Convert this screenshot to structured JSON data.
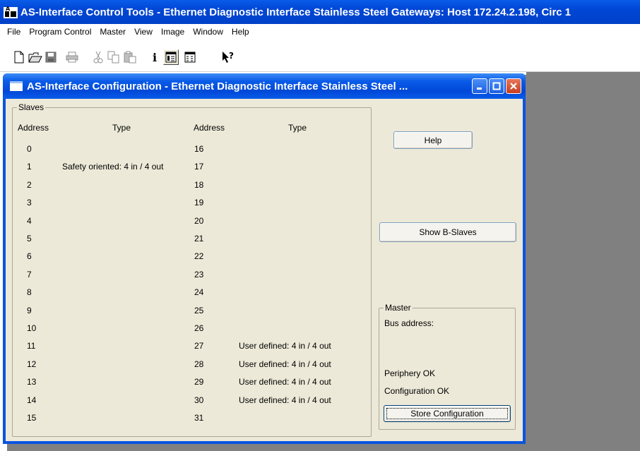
{
  "app": {
    "title": "AS-Interface Control Tools - Ethernet Diagnostic Interface Stainless Steel Gateways: Host 172.24.2.198, Circ 1"
  },
  "menubar": {
    "items": [
      "File",
      "Program Control",
      "Master",
      "View",
      "Image",
      "Window",
      "Help"
    ]
  },
  "toolbar": {
    "info_glyph": "i"
  },
  "window": {
    "title": "AS-Interface Configuration - Ethernet Diagnostic Interface Stainless Steel ..."
  },
  "slaves": {
    "group_label": "Slaves",
    "headers": {
      "address": "Address",
      "type": "Type"
    },
    "left": [
      {
        "address": "0",
        "type": ""
      },
      {
        "address": "1",
        "type": "Safety oriented: 4 in / 4 out"
      },
      {
        "address": "2",
        "type": ""
      },
      {
        "address": "3",
        "type": ""
      },
      {
        "address": "4",
        "type": ""
      },
      {
        "address": "5",
        "type": ""
      },
      {
        "address": "6",
        "type": ""
      },
      {
        "address": "7",
        "type": ""
      },
      {
        "address": "8",
        "type": ""
      },
      {
        "address": "9",
        "type": ""
      },
      {
        "address": "10",
        "type": ""
      },
      {
        "address": "11",
        "type": ""
      },
      {
        "address": "12",
        "type": ""
      },
      {
        "address": "13",
        "type": ""
      },
      {
        "address": "14",
        "type": ""
      },
      {
        "address": "15",
        "type": ""
      }
    ],
    "right": [
      {
        "address": "16",
        "type": ""
      },
      {
        "address": "17",
        "type": ""
      },
      {
        "address": "18",
        "type": ""
      },
      {
        "address": "19",
        "type": ""
      },
      {
        "address": "20",
        "type": ""
      },
      {
        "address": "21",
        "type": ""
      },
      {
        "address": "22",
        "type": ""
      },
      {
        "address": "23",
        "type": ""
      },
      {
        "address": "24",
        "type": ""
      },
      {
        "address": "25",
        "type": ""
      },
      {
        "address": "26",
        "type": ""
      },
      {
        "address": "27",
        "type": "User defined: 4 in / 4 out"
      },
      {
        "address": "28",
        "type": "User defined: 4 in / 4 out"
      },
      {
        "address": "29",
        "type": "User defined: 4 in / 4 out"
      },
      {
        "address": "30",
        "type": "User defined: 4 in / 4 out"
      },
      {
        "address": "31",
        "type": ""
      }
    ]
  },
  "buttons": {
    "help": "Help",
    "show_b_slaves": "Show B-Slaves",
    "store_configuration": "Store Configuration"
  },
  "master": {
    "group_label": "Master",
    "bus_address_label": "Bus address:",
    "periphery_status": "Periphery OK",
    "configuration_status": "Configuration OK"
  },
  "colors": {
    "titlebar": "#0a5ce8",
    "dialog_bg": "#ece9d8",
    "mdi_bg": "#808080",
    "close_button": "#d9532f"
  }
}
